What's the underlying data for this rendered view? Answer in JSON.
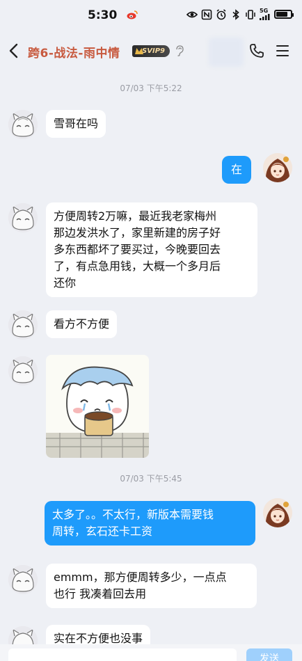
{
  "status_bar": {
    "time": "5:30",
    "network_label": "5G"
  },
  "header": {
    "title": "跨6-战法-雨中情",
    "badge": "SVIP9"
  },
  "messages": [
    {
      "type": "timestamp",
      "text": "07/03 下午5:22"
    },
    {
      "type": "text",
      "side": "left",
      "text": "雪哥在吗"
    },
    {
      "type": "text",
      "side": "right",
      "text": "在"
    },
    {
      "type": "text",
      "side": "left",
      "lines": [
        "方便周转2万嘛，最近我老家梅州",
        "那边发洪水了，家里新建的房子好",
        "多东西都坏了要买过，今晚要回去",
        "了，有点急用钱，大概一个多月后",
        "还你"
      ]
    },
    {
      "type": "text",
      "side": "left",
      "text": "看方不方便"
    },
    {
      "type": "sticker",
      "side": "left"
    },
    {
      "type": "timestamp",
      "text": "07/03 下午5:45"
    },
    {
      "type": "text",
      "side": "right",
      "lines": [
        "太多了。。不太行，新版本需要钱",
        "周转，玄石还卡工资"
      ]
    },
    {
      "type": "text",
      "side": "left",
      "lines": [
        "emmm，那方便周转多少，一点点",
        "也行 我凑着回去用"
      ]
    },
    {
      "type": "text",
      "side": "left",
      "text": "实在不方便也没事"
    }
  ],
  "input": {
    "send_label": "发送"
  },
  "colors": {
    "background": "#eef0f5",
    "bubble_right": "#1e9bfb",
    "bubble_left": "#ffffff",
    "title": "#c85a3f"
  },
  "icons": [
    "back-icon",
    "weibo-icon",
    "eye-icon",
    "nfc-icon",
    "alarm-icon",
    "bluetooth-icon",
    "vibrate-icon",
    "signal-icon",
    "battery-icon",
    "ear-icon",
    "phone-icon",
    "menu-icon"
  ]
}
